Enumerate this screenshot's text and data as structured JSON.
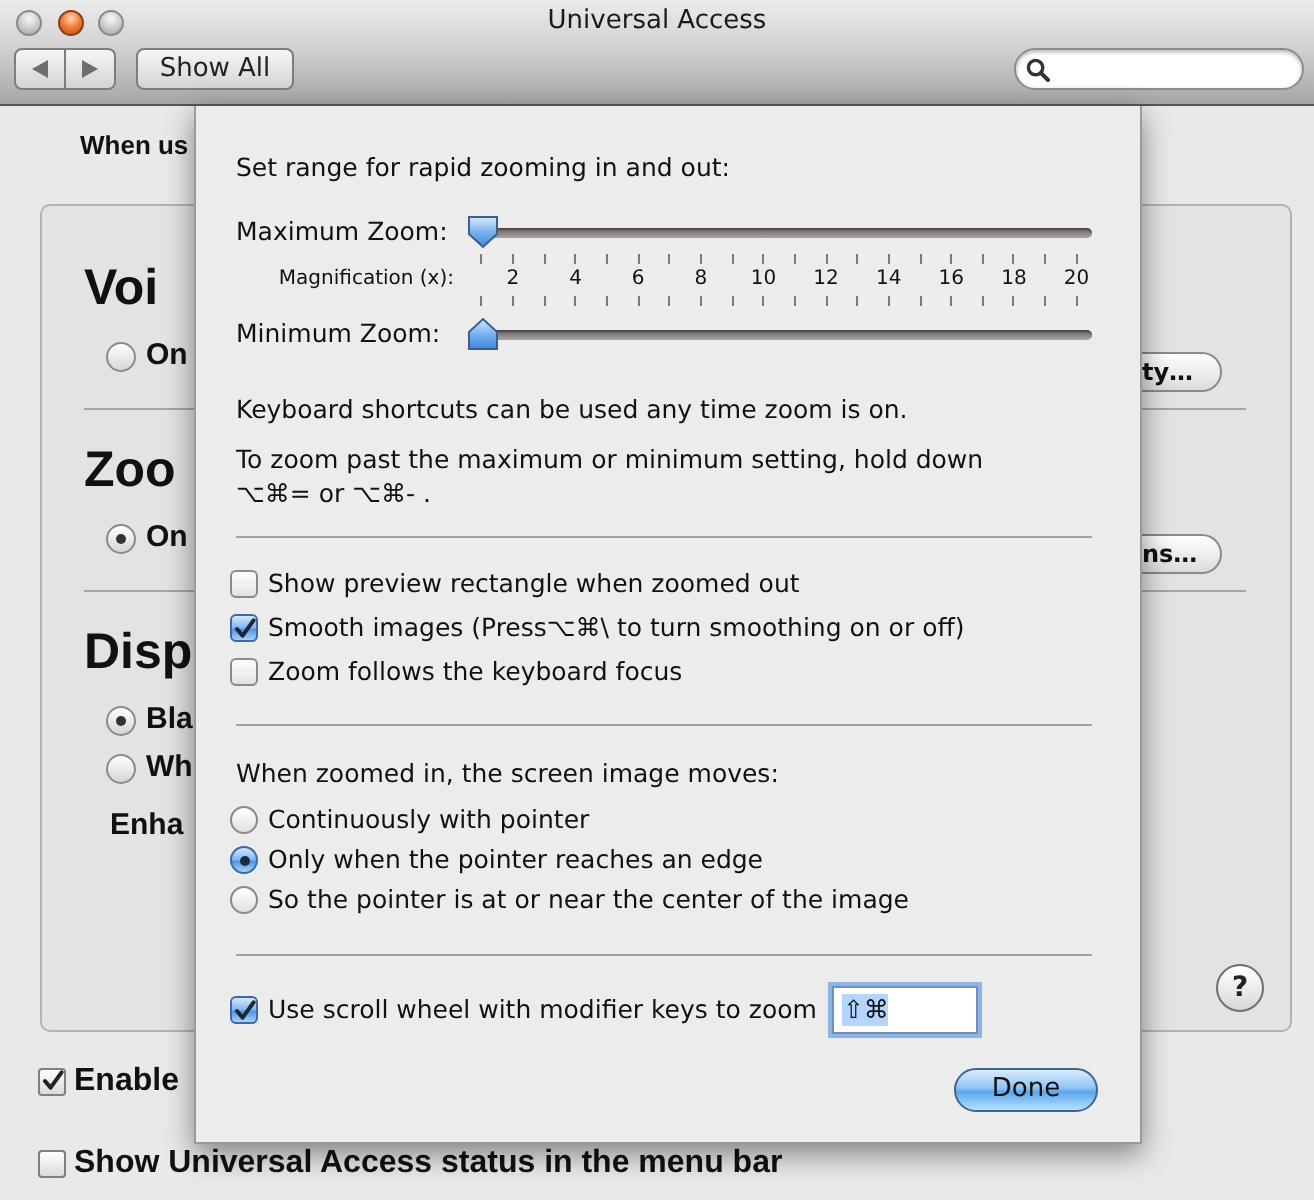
{
  "window": {
    "title": "Universal Access",
    "controls": [
      {
        "kind": "close",
        "disabled": true
      },
      {
        "kind": "minimize",
        "disabled": false
      },
      {
        "kind": "zoom",
        "disabled": true
      }
    ]
  },
  "toolbar": {
    "show_all": "Show All"
  },
  "background": {
    "intro": "When us",
    "sections": [
      {
        "title": "Voi",
        "radios": [
          {
            "label": "On",
            "selected": false
          }
        ],
        "button": "ty…"
      },
      {
        "title": "Zoo",
        "radios": [
          {
            "label": "On",
            "selected": true
          }
        ],
        "button": "ns…"
      },
      {
        "title": "Disp",
        "radios": [
          {
            "label": "Bla",
            "selected": true
          },
          {
            "label": "Wh",
            "selected": false
          }
        ],
        "note": "Enha"
      }
    ],
    "help": "?",
    "checkboxes": [
      {
        "label": "Enable",
        "checked": true
      },
      {
        "label": "Show Universal Access status in the menu bar",
        "checked": false
      }
    ]
  },
  "sheet": {
    "range_heading": "Set range for rapid zooming in and out:",
    "max_zoom": {
      "label": "Maximum Zoom:",
      "level": 0
    },
    "scale": {
      "label": "Magnification (x):",
      "values": [
        "2",
        "4",
        "6",
        "8",
        "10",
        "12",
        "14",
        "16",
        "18",
        "20"
      ]
    },
    "min_zoom": {
      "label": "Minimum Zoom:",
      "level": 0
    },
    "shortcuts_note": "Keyboard shortcuts can be used any time zoom is on.",
    "hold_note": [
      "To zoom past the maximum or minimum setting, hold down",
      "⌥⌘= or ⌥⌘- ."
    ],
    "options": [
      {
        "label": "Show preview rectangle when zoomed out",
        "checked": false
      },
      {
        "label": "Smooth images (Press⌥⌘\\ to turn smoothing on or off)",
        "checked": true
      },
      {
        "label": "Zoom follows the keyboard focus",
        "checked": false
      }
    ],
    "movement": {
      "heading": "When zoomed in, the screen image moves:",
      "choices": [
        {
          "label": "Continuously with pointer",
          "selected": false
        },
        {
          "label": "Only when the pointer reaches an edge",
          "selected": true
        },
        {
          "label": "So the pointer is at or near the center of the image",
          "selected": false
        }
      ]
    },
    "scroll_wheel": {
      "label": "Use scroll wheel with modifier keys to zoom",
      "checked": true,
      "value": "⇧⌘",
      "value_selected": true
    },
    "done": "Done"
  }
}
